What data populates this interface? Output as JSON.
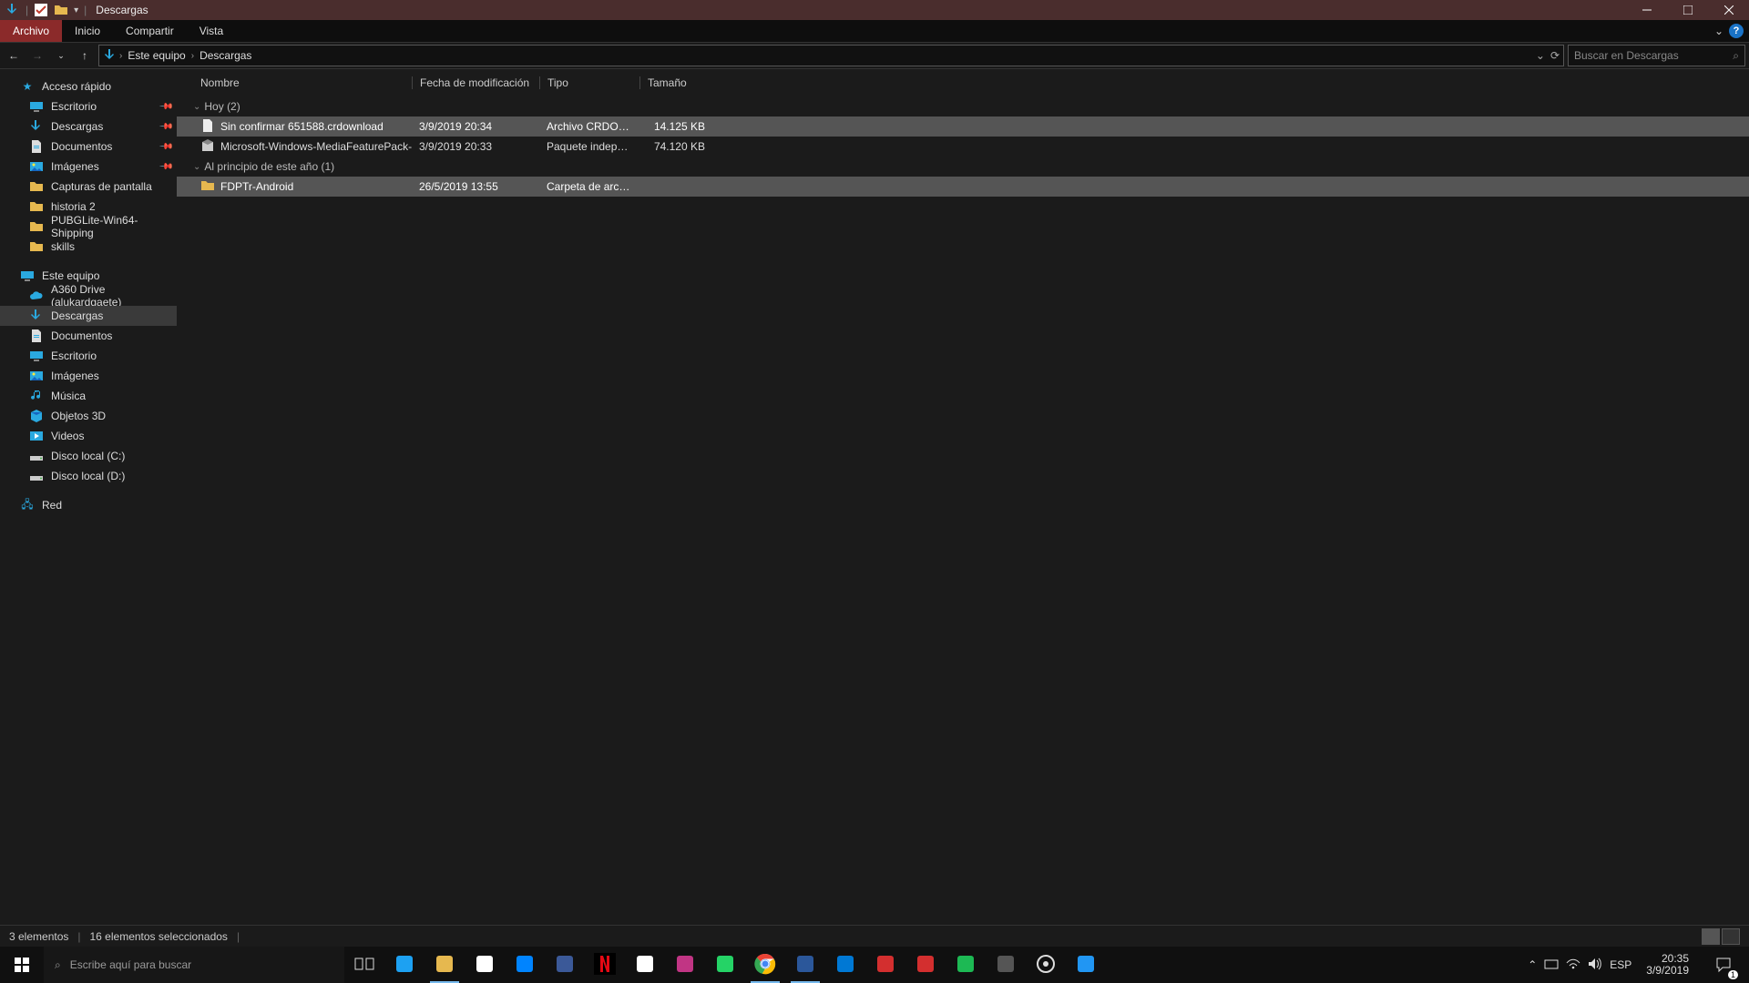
{
  "window": {
    "title": "Descargas"
  },
  "ribbon": {
    "tabs": [
      "Archivo",
      "Inicio",
      "Compartir",
      "Vista"
    ],
    "active": "Archivo"
  },
  "addressbar": {
    "crumbs": [
      "Este equipo",
      "Descargas"
    ]
  },
  "search": {
    "placeholder": "Buscar en Descargas"
  },
  "sidebar": {
    "quick_access": {
      "label": "Acceso rápido"
    },
    "quick_items": [
      {
        "label": "Escritorio",
        "pinned": true,
        "icon": "desktop"
      },
      {
        "label": "Descargas",
        "pinned": true,
        "icon": "downloads"
      },
      {
        "label": "Documentos",
        "pinned": true,
        "icon": "documents"
      },
      {
        "label": "Imágenes",
        "pinned": true,
        "icon": "pictures"
      },
      {
        "label": "Capturas de pantalla",
        "pinned": false,
        "icon": "folder"
      },
      {
        "label": "historia 2",
        "pinned": false,
        "icon": "folder"
      },
      {
        "label": "PUBGLite-Win64-Shipping",
        "pinned": false,
        "icon": "folder"
      },
      {
        "label": "skills",
        "pinned": false,
        "icon": "folder"
      }
    ],
    "this_pc": {
      "label": "Este equipo"
    },
    "pc_items": [
      {
        "label": "A360 Drive (alukardgaete)",
        "icon": "cloud"
      },
      {
        "label": "Descargas",
        "icon": "downloads",
        "selected": true
      },
      {
        "label": "Documentos",
        "icon": "documents"
      },
      {
        "label": "Escritorio",
        "icon": "desktop"
      },
      {
        "label": "Imágenes",
        "icon": "pictures"
      },
      {
        "label": "Música",
        "icon": "music"
      },
      {
        "label": "Objetos 3D",
        "icon": "objects3d"
      },
      {
        "label": "Videos",
        "icon": "videos"
      },
      {
        "label": "Disco local (C:)",
        "icon": "drive"
      },
      {
        "label": "Disco local (D:)",
        "icon": "drive"
      }
    ],
    "network": {
      "label": "Red"
    }
  },
  "columns": {
    "name": "Nombre",
    "date": "Fecha de modificación",
    "type": "Tipo",
    "size": "Tamaño"
  },
  "groups": [
    {
      "label": "Hoy (2)",
      "files": [
        {
          "name": "Sin confirmar 651588.crdownload",
          "date": "3/9/2019 20:34",
          "type": "Archivo CRDOWN...",
          "size": "14.125 KB",
          "icon": "file",
          "selected": true
        },
        {
          "name": "Microsoft-Windows-MediaFeaturePack-O...",
          "date": "3/9/2019 20:33",
          "type": "Paquete independi...",
          "size": "74.120 KB",
          "icon": "package",
          "selected": false
        }
      ]
    },
    {
      "label": "Al principio de este año (1)",
      "files": [
        {
          "name": "FDPTr-Android",
          "date": "26/5/2019 13:55",
          "type": "Carpeta de archivos",
          "size": "",
          "icon": "folder",
          "selected": true
        }
      ]
    }
  ],
  "statusbar": {
    "count": "3 elementos",
    "selection": "16 elementos seleccionados"
  },
  "taskbar": {
    "search_placeholder": "Escribe aquí para buscar",
    "lang": "ESP",
    "time": "20:35",
    "date": "3/9/2019",
    "notif_count": "1"
  },
  "colors": {
    "accent_tab": "#8b2a2a",
    "titlebar": "#4a2d2d",
    "selection": "#555555"
  },
  "taskbar_apps": [
    "task-view",
    "twitter",
    "file-explorer",
    "ms-store",
    "messenger",
    "facebook",
    "netflix",
    "nletter",
    "instagram",
    "whatsapp",
    "chrome",
    "word",
    "calendar",
    "autocad",
    "msi",
    "spotify",
    "ninja",
    "settings",
    "lutris"
  ]
}
